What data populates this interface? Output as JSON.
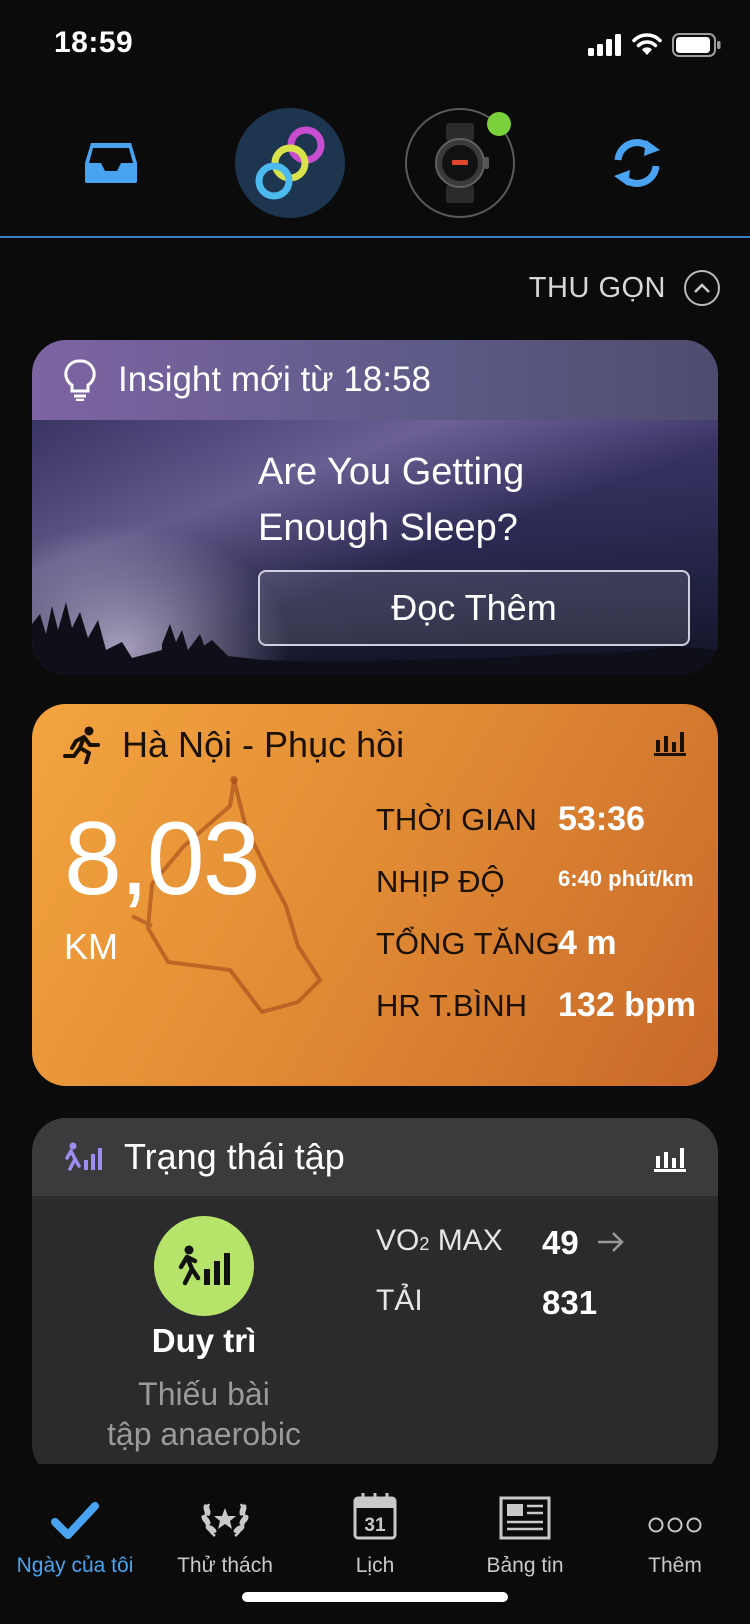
{
  "status_bar": {
    "time": "18:59"
  },
  "header": {
    "collapse_label": "THU GỌN",
    "colors": {
      "accent": "#3d7ec6",
      "device_online": "#7bd13b"
    }
  },
  "insight": {
    "header": "Insight mới từ 18:58",
    "title_line1": "Are You Getting",
    "title_line2": "Enough Sleep?",
    "button": "Đọc Thêm"
  },
  "activity": {
    "title": "Hà Nội - Phục hồi",
    "distance": "8,03",
    "distance_unit": "KM",
    "stats": [
      {
        "label": "THỜI GIAN",
        "value": "53:36"
      },
      {
        "label": "NHỊP ĐỘ",
        "value": "6:40 phút/km"
      },
      {
        "label": "TỔNG TĂNG",
        "value": "4 m"
      },
      {
        "label": "HR T.BÌNH",
        "value": "132 bpm"
      }
    ],
    "colors": {
      "start": "#f3a43f",
      "end": "#c8682a"
    }
  },
  "training_status": {
    "title": "Trạng thái tập",
    "status": "Duy trì",
    "sub_line1": "Thiếu bài",
    "sub_line2": "tập anaerobic",
    "vo2_label_pre": "VO",
    "vo2_sub": "2",
    "vo2_label_post": " MAX",
    "vo2_value": "49",
    "load_label": "TẢI",
    "load_value": "831",
    "colors": {
      "badge": "#b6e46a",
      "icon": "#9c8ef0"
    }
  },
  "tabs": [
    {
      "label": "Ngày của tôi",
      "icon": "checkmark-icon",
      "active": true
    },
    {
      "label": "Thử thách",
      "icon": "laurel-icon"
    },
    {
      "label": "Lịch",
      "icon": "calendar-icon",
      "day": "31"
    },
    {
      "label": "Bảng tin",
      "icon": "newspaper-icon"
    },
    {
      "label": "Thêm",
      "icon": "more-dots-icon"
    }
  ]
}
